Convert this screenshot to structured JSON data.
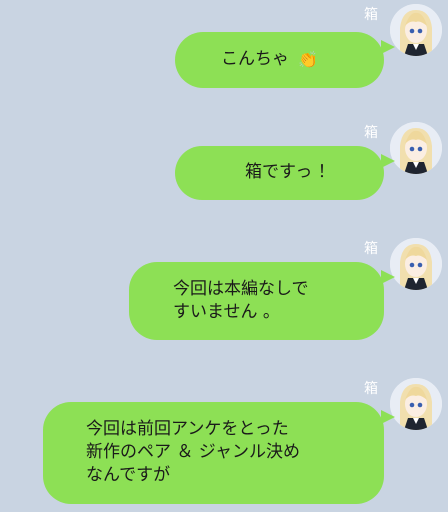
{
  "background_color": "#c9d4e2",
  "bubble_color": "#8de055",
  "sender_name": "箱",
  "messages": [
    {
      "lines": [
        "こんちゃ"
      ],
      "emoji": "👏",
      "emoji_name": "clapping-hands-icon"
    },
    {
      "lines": [
        "箱ですっ ！"
      ]
    },
    {
      "lines": [
        "今回は本編なしで",
        "すいません 。"
      ]
    },
    {
      "lines": [
        "今回は前回アンケをとった",
        "新作のペア ＆ ジャンル決め",
        "なんですが"
      ]
    }
  ]
}
